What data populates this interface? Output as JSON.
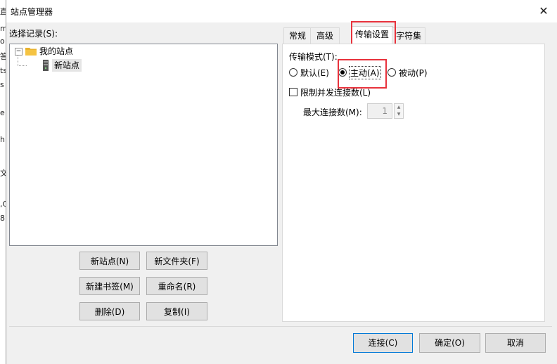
{
  "background_window": {
    "edge_chars": [
      "直",
      "m",
      "o",
      "答",
      "ts",
      "s",
      "e",
      "hi",
      "文",
      ",C",
      "8"
    ]
  },
  "dialog": {
    "title": "站点管理器",
    "close_glyph": "✕"
  },
  "left": {
    "records_label": "选择记录(S):",
    "tree": {
      "expander": "−",
      "root_label": "我的站点",
      "site_label": "新站点"
    },
    "buttons": {
      "new_site": "新站点(N)",
      "new_folder": "新文件夹(F)",
      "new_bookmark": "新建书签(M)",
      "rename": "重命名(R)",
      "delete": "删除(D)",
      "copy": "复制(I)"
    }
  },
  "tabs": [
    {
      "label": "常规",
      "active": false
    },
    {
      "label": "高级",
      "active": false
    },
    {
      "label": "传输设置",
      "active": true
    },
    {
      "label": "字符集",
      "active": false
    }
  ],
  "transfer": {
    "mode_label": "传输模式(T):",
    "options": [
      {
        "label": "默认(E)",
        "selected": false
      },
      {
        "label": "主动(A)",
        "selected": true
      },
      {
        "label": "被动(P)",
        "selected": false
      }
    ],
    "limit_label": "限制并发连接数(L)",
    "limit_checked": false,
    "max_label": "最大连接数(M):",
    "max_value": "1"
  },
  "footer": {
    "connect": "连接(C)",
    "ok": "确定(O)",
    "cancel": "取消"
  },
  "colors": {
    "highlight": "#e8323c",
    "folder": "#f5c342"
  }
}
